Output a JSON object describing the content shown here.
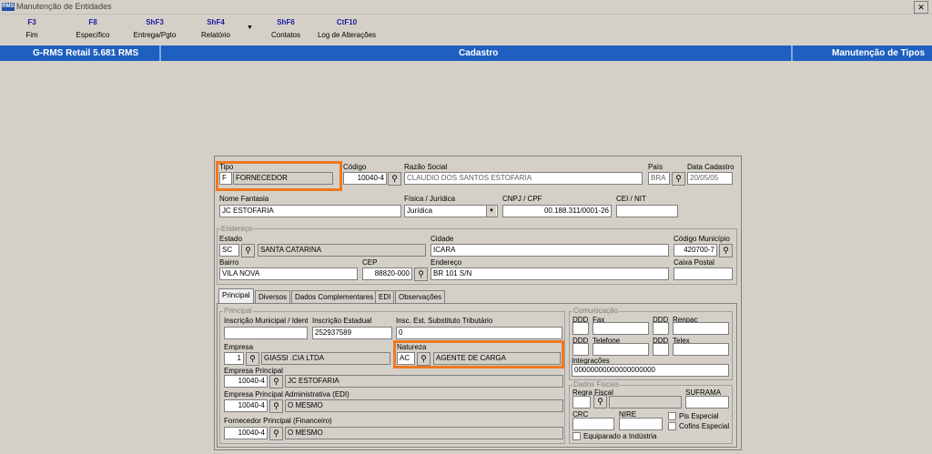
{
  "window": {
    "title": "Manutenção de Entidades",
    "app_icon": "rms-icon",
    "close_label": "✕"
  },
  "toolbar": [
    {
      "key": "F3",
      "label": "Fim"
    },
    {
      "key": "F8",
      "label": "Específico"
    },
    {
      "key": "ShF3",
      "label": "Entrega/Pgto"
    },
    {
      "key": "ShF4",
      "label": "Relatório"
    },
    {
      "key": "ShF6",
      "label": "Contatos"
    },
    {
      "key": "CtF10",
      "label": "Log de Alterações"
    }
  ],
  "toolbar_dropdown": "▼",
  "band": {
    "left": "G-RMS Retail 5.681 RMS",
    "center": "Cadastro",
    "right": "Manutenção de Tipos"
  },
  "form": {
    "tipo": {
      "label": "Tipo",
      "code": "F",
      "desc": "FORNECEDOR"
    },
    "codigo": {
      "label": "Código",
      "value": "10040-4"
    },
    "razao": {
      "label": "Razão Social",
      "value": "CLAUDIO DOS SANTOS ESTOFARIA"
    },
    "pais": {
      "label": "País",
      "value": "BRA"
    },
    "data_cadastro": {
      "label": "Data Cadastro",
      "value": "20/05/05"
    },
    "nome_fantasia": {
      "label": "Nome Fantasia",
      "value": "JC ESTOFARIA"
    },
    "fisica_juridica": {
      "label": "Física / Jurídica",
      "value": "Jurídica"
    },
    "cnpj": {
      "label": "CNPJ / CPF",
      "value": "00.188.311/0001-26"
    },
    "cei": {
      "label": "CEI / NIT",
      "value": ""
    },
    "endereco_group": "Endereço",
    "estado": {
      "label": "Estado",
      "code": "SC",
      "desc": "SANTA CATARINA"
    },
    "cidade": {
      "label": "Cidade",
      "value": "ICARA"
    },
    "cod_municipio": {
      "label": "Código Município",
      "value": "420700-7"
    },
    "bairro": {
      "label": "Bairro",
      "value": "VILA NOVA"
    },
    "cep": {
      "label": "CEP",
      "value": "88820-000"
    },
    "endereco": {
      "label": "Endereço",
      "value": "BR 101 S/N"
    },
    "caixa_postal": {
      "label": "Caixa Postal",
      "value": ""
    }
  },
  "tabs": [
    "Principal",
    "Diversos",
    "Dados Complementares",
    "EDI",
    "Observações"
  ],
  "principal": {
    "group": "Principal",
    "insc_municipal": {
      "label": "Inscrição Municipal / Ident",
      "value": ""
    },
    "insc_estadual": {
      "label": "Inscrição Estadual",
      "value": "252937589"
    },
    "insc_subst": {
      "label": "Insc. Est. Substituto Tributário",
      "value": "0"
    },
    "empresa": {
      "label": "Empresa",
      "code": "1",
      "desc": "GIASSI .CIA LTDA"
    },
    "natureza": {
      "label": "Natureza",
      "code": "AC",
      "desc": "AGENTE DE CARGA"
    },
    "empresa_principal": {
      "label": "Empresa Principal",
      "code": "10040-4",
      "desc": "JC ESTOFARIA"
    },
    "empresa_adm": {
      "label": "Empresa Principal Administrativa (EDI)",
      "code": "10040-4",
      "desc": "O MESMO"
    },
    "fornecedor_principal": {
      "label": "Fornecedor Principal (Financeiro)",
      "code": "10040-4",
      "desc": "O MESMO"
    }
  },
  "comunicacao": {
    "group": "Comunicação",
    "ddd1": "DDD",
    "fax": "Fax",
    "ddd2": "DDD",
    "renpac": "Renpac",
    "ddd3": "DDD",
    "telefone": "Telefone",
    "ddd4": "DDD",
    "telex": "Telex",
    "integracoes_label": "Integrações",
    "integracoes_value": "00000000000000000000"
  },
  "fiscais": {
    "group": "Dados Fiscais",
    "regra_fiscal": "Regra Fiscal",
    "suframa": "SUFRAMA",
    "crc": "CRC",
    "nire": "NIRE",
    "pis": "Pis Especial",
    "cofins": "Cofins Especial",
    "equiparado": "Equiparado a Indústria"
  },
  "colors": {
    "band": "#1f5fbf",
    "highlight": "#f07820",
    "toolbar_key": "#1a1aa0"
  }
}
